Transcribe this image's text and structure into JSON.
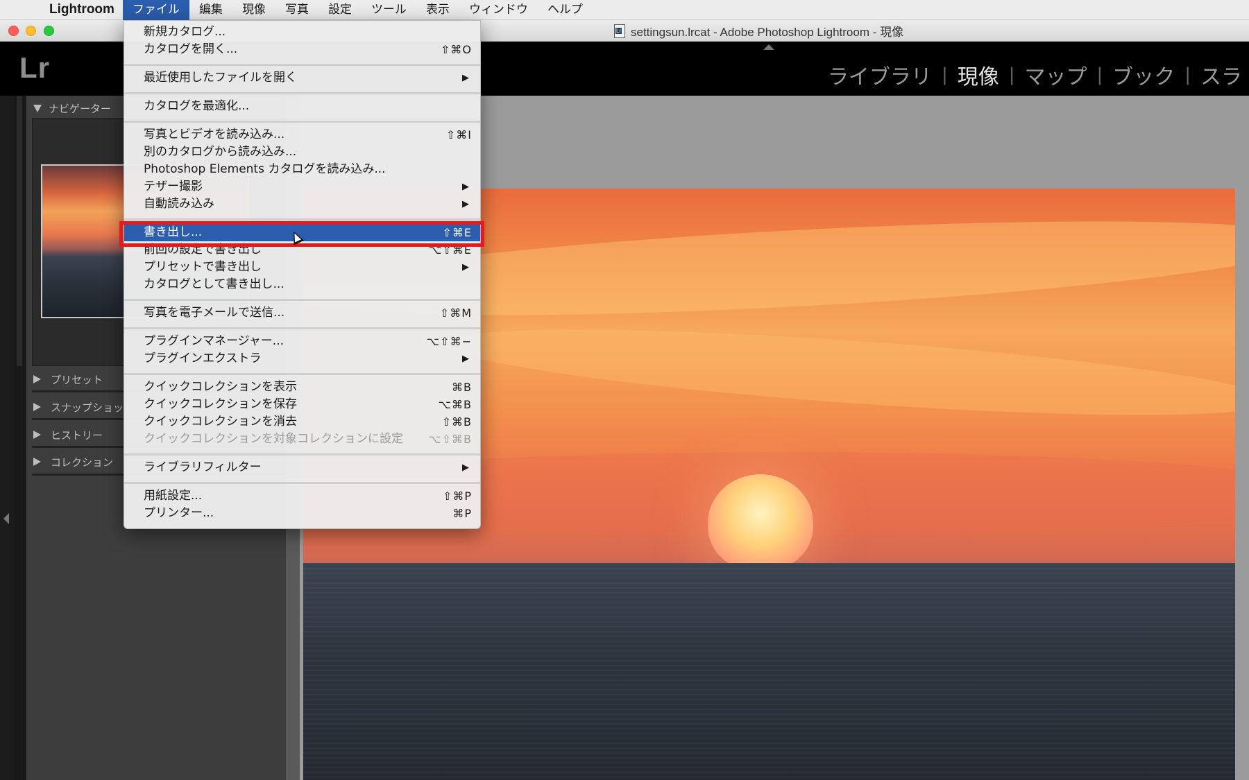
{
  "menubar": {
    "apple": "",
    "app_name": "Lightroom",
    "items": [
      "ファイル",
      "編集",
      "現像",
      "写真",
      "設定",
      "ツール",
      "表示",
      "ウィンドウ",
      "ヘルプ"
    ],
    "active_index": 0
  },
  "window": {
    "title": "settingsun.lrcat - Adobe Photoshop Lightroom - 現像"
  },
  "header": {
    "logo": "Lr",
    "modules": [
      "ライブラリ",
      "現像",
      "マップ",
      "ブック",
      "スラ"
    ],
    "active_module": "現像",
    "separator": "|"
  },
  "left_panel": {
    "navigator_label": "ナビゲーター",
    "sections": [
      "プリセット",
      "スナップショット",
      "ヒストリー",
      "コレクション"
    ]
  },
  "file_menu": {
    "groups": [
      [
        {
          "label": "新規カタログ...",
          "shortcut": ""
        },
        {
          "label": "カタログを開く...",
          "shortcut": "⇧⌘O"
        }
      ],
      [
        {
          "label": "最近使用したファイルを開く",
          "shortcut": "",
          "submenu": true
        }
      ],
      [
        {
          "label": "カタログを最適化...",
          "shortcut": ""
        }
      ],
      [
        {
          "label": "写真とビデオを読み込み...",
          "shortcut": "⇧⌘I"
        },
        {
          "label": "別のカタログから読み込み...",
          "shortcut": ""
        },
        {
          "label": "Photoshop Elements カタログを読み込み...",
          "shortcut": ""
        },
        {
          "label": "テザー撮影",
          "shortcut": "",
          "submenu": true
        },
        {
          "label": "自動読み込み",
          "shortcut": "",
          "submenu": true
        }
      ],
      [
        {
          "label": "書き出し...",
          "shortcut": "⇧⌘E",
          "selected": true
        },
        {
          "label": "前回の設定で書き出し",
          "shortcut": "⌥⇧⌘E"
        },
        {
          "label": "プリセットで書き出し",
          "shortcut": "",
          "submenu": true
        },
        {
          "label": "カタログとして書き出し...",
          "shortcut": ""
        }
      ],
      [
        {
          "label": "写真を電子メールで送信...",
          "shortcut": "⇧⌘M"
        }
      ],
      [
        {
          "label": "プラグインマネージャー...",
          "shortcut": "⌥⇧⌘−"
        },
        {
          "label": "プラグインエクストラ",
          "shortcut": "",
          "submenu": true
        }
      ],
      [
        {
          "label": "クイックコレクションを表示",
          "shortcut": "⌘B"
        },
        {
          "label": "クイックコレクションを保存",
          "shortcut": "⌥⌘B"
        },
        {
          "label": "クイックコレクションを消去",
          "shortcut": "⇧⌘B"
        },
        {
          "label": "クイックコレクションを対象コレクションに設定",
          "shortcut": "⌥⇧⌘B",
          "disabled": true
        }
      ],
      [
        {
          "label": "ライブラリフィルター",
          "shortcut": "",
          "submenu": true
        }
      ],
      [
        {
          "label": "用紙設定...",
          "shortcut": "⇧⌘P"
        },
        {
          "label": "プリンター...",
          "shortcut": "⌘P"
        }
      ]
    ],
    "submenu_arrow": "▶"
  },
  "colors": {
    "menu_highlight": "#2a5dad",
    "annotation_box": "#e8191c"
  }
}
